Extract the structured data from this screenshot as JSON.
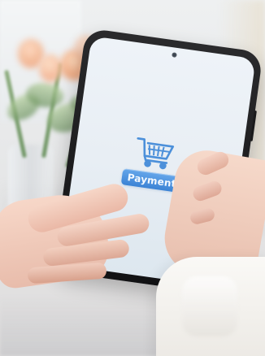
{
  "screen": {
    "cart_icon": "shopping-cart-icon",
    "payment_label": "Payment"
  },
  "colors": {
    "screen": "#edf2f7",
    "payment_button": "#4a95e3",
    "payment_text": "#f4f9ff",
    "phone": "#1c1c1e"
  }
}
